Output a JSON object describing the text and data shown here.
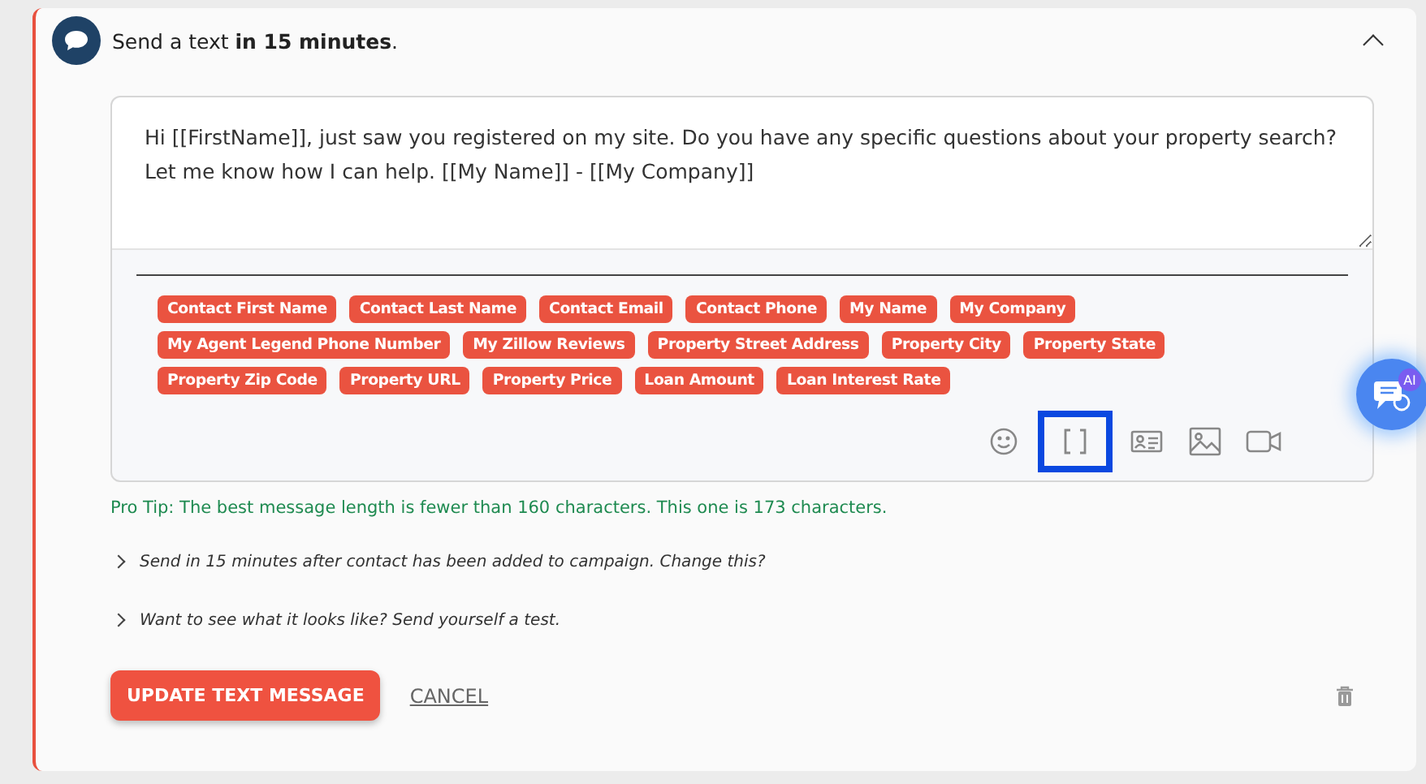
{
  "header": {
    "title": "Send a text **in 15 minutes**.",
    "expanded": true
  },
  "message": {
    "value": "Hi [[FirstName]], just saw you registered on my site. Do you have any specific questions about your property search? Let me know how I can help. [[My Name]] - [[My Company]]"
  },
  "merge_tags": [
    "Contact First Name",
    "Contact Last Name",
    "Contact Email",
    "Contact Phone",
    "My Name",
    "My Company",
    "My Agent Legend Phone Number",
    "My Zillow Reviews",
    "Property Street Address",
    "Property City",
    "Property State",
    "Property Zip Code",
    "Property URL",
    "Property Price",
    "Loan Amount",
    "Loan Interest Rate"
  ],
  "toolbar": [
    {
      "kind": "emoji",
      "highlighted": false
    },
    {
      "kind": "brackets",
      "highlighted": true
    },
    {
      "kind": "contact-card",
      "highlighted": false
    },
    {
      "kind": "image",
      "highlighted": false
    },
    {
      "kind": "video",
      "highlighted": false
    }
  ],
  "pro_tip": "Pro Tip: The best message length is fewer than 160 characters. This one is 173 characters.",
  "options": [
    {
      "text": "Send in 15 minutes after contact has been added to campaign. Change this?",
      "expanded": false
    },
    {
      "text": "Want to see what it looks like? Send yourself a test.",
      "expanded": false
    }
  ],
  "buttons": {
    "primary": "UPDATE TEXT MESSAGE",
    "secondary": "CANCEL"
  },
  "ai_button": {
    "badge": "AI"
  }
}
